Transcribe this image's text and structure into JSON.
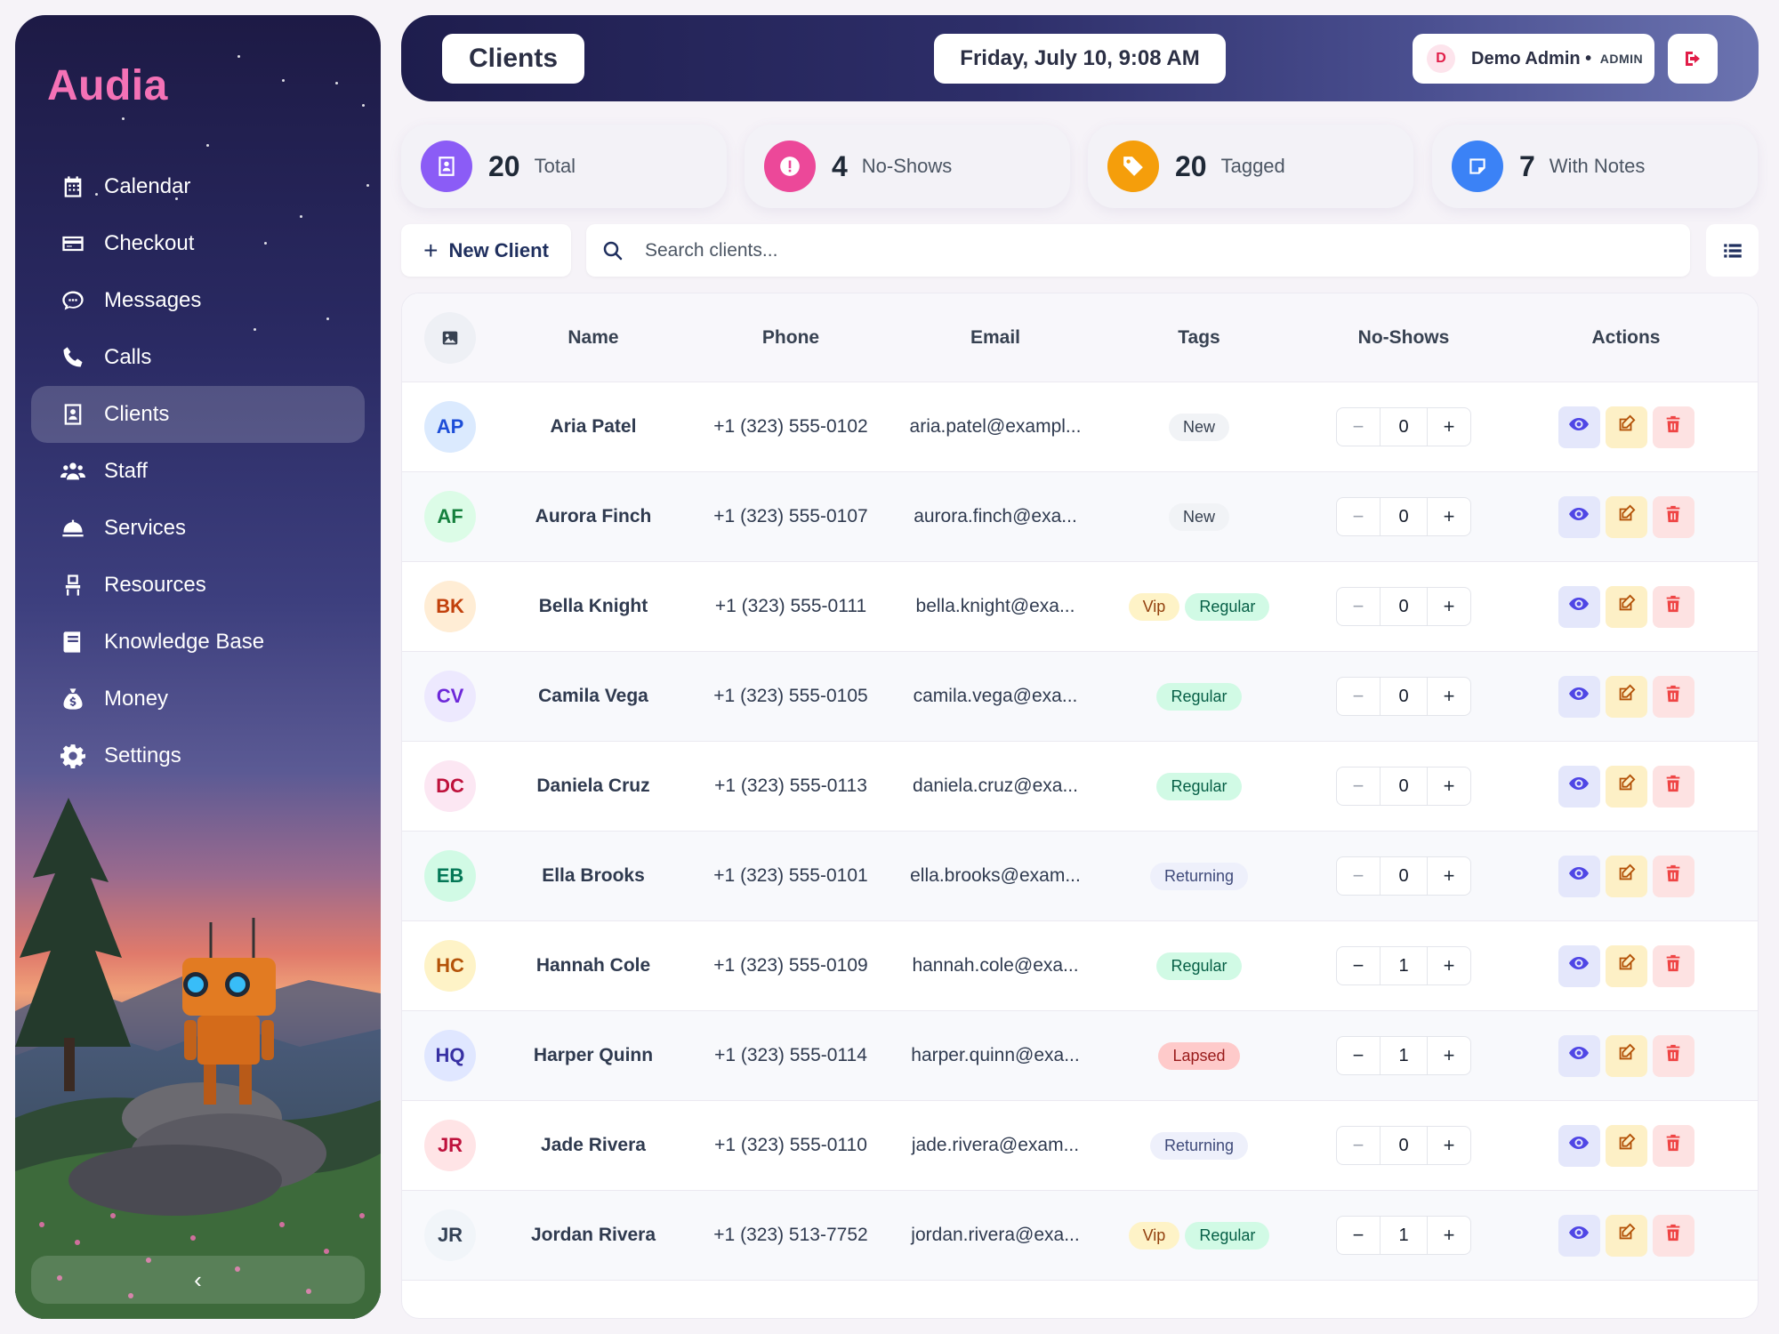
{
  "brand": "Audia",
  "nav": [
    {
      "label": "Calendar",
      "icon": "calendar-icon",
      "active": false
    },
    {
      "label": "Checkout",
      "icon": "credit-card-icon",
      "active": false
    },
    {
      "label": "Messages",
      "icon": "chat-bubble-icon",
      "active": false
    },
    {
      "label": "Calls",
      "icon": "phone-icon",
      "active": false
    },
    {
      "label": "Clients",
      "icon": "contact-card-icon",
      "active": true
    },
    {
      "label": "Staff",
      "icon": "users-icon",
      "active": false
    },
    {
      "label": "Services",
      "icon": "concierge-bell-icon",
      "active": false
    },
    {
      "label": "Resources",
      "icon": "chair-icon",
      "active": false
    },
    {
      "label": "Knowledge Base",
      "icon": "book-icon",
      "active": false
    },
    {
      "label": "Money",
      "icon": "money-bag-icon",
      "active": false
    },
    {
      "label": "Settings",
      "icon": "gear-icon",
      "active": false
    }
  ],
  "sidebar_collapse": "‹",
  "header": {
    "title": "Clients",
    "datetime": "Friday, July 10, 9:08 AM",
    "user_initial": "D",
    "user_name": "Demo Admin",
    "user_sep": " • ",
    "user_role": "ADMIN"
  },
  "stats": [
    {
      "value": "20",
      "label": "Total",
      "color": "#8b5cf6",
      "icon": "contact-card-icon"
    },
    {
      "value": "4",
      "label": "No-Shows",
      "color": "#ec4899",
      "icon": "alert-icon"
    },
    {
      "value": "20",
      "label": "Tagged",
      "color": "#f59e0b",
      "icon": "tag-icon"
    },
    {
      "value": "7",
      "label": "With Notes",
      "color": "#3b82f6",
      "icon": "note-icon"
    }
  ],
  "toolbar": {
    "new_client_label": "New Client",
    "search_placeholder": "Search clients..."
  },
  "table": {
    "headers": [
      "Name",
      "Phone",
      "Email",
      "Tags",
      "No-Shows",
      "Actions"
    ],
    "rows": [
      {
        "initials": "AP",
        "name": "Aria Patel",
        "phone": "+1 (323) 555-0102",
        "email": "aria.patel@exampl...",
        "tags": [
          "New"
        ],
        "noshows": "0",
        "av_bg": "#dbeafe",
        "av_fg": "#1d4ed8"
      },
      {
        "initials": "AF",
        "name": "Aurora Finch",
        "phone": "+1 (323) 555-0107",
        "email": "aurora.finch@exa...",
        "tags": [
          "New"
        ],
        "noshows": "0",
        "av_bg": "#dcfce7",
        "av_fg": "#15803d"
      },
      {
        "initials": "BK",
        "name": "Bella Knight",
        "phone": "+1 (323) 555-0111",
        "email": "bella.knight@exa...",
        "tags": [
          "Vip",
          "Regular"
        ],
        "noshows": "0",
        "av_bg": "#ffedd5",
        "av_fg": "#c2410c"
      },
      {
        "initials": "CV",
        "name": "Camila Vega",
        "phone": "+1 (323) 555-0105",
        "email": "camila.vega@exa...",
        "tags": [
          "Regular"
        ],
        "noshows": "0",
        "av_bg": "#ede9fe",
        "av_fg": "#6d28d9"
      },
      {
        "initials": "DC",
        "name": "Daniela Cruz",
        "phone": "+1 (323) 555-0113",
        "email": "daniela.cruz@exa...",
        "tags": [
          "Regular"
        ],
        "noshows": "0",
        "av_bg": "#fce7f3",
        "av_fg": "#be123c"
      },
      {
        "initials": "EB",
        "name": "Ella Brooks",
        "phone": "+1 (323) 555-0101",
        "email": "ella.brooks@exam...",
        "tags": [
          "Returning"
        ],
        "noshows": "0",
        "av_bg": "#d1fae5",
        "av_fg": "#047857"
      },
      {
        "initials": "HC",
        "name": "Hannah Cole",
        "phone": "+1 (323) 555-0109",
        "email": "hannah.cole@exa...",
        "tags": [
          "Regular"
        ],
        "noshows": "1",
        "av_bg": "#fef3c7",
        "av_fg": "#b45309"
      },
      {
        "initials": "HQ",
        "name": "Harper Quinn",
        "phone": "+1 (323) 555-0114",
        "email": "harper.quinn@exa...",
        "tags": [
          "Lapsed"
        ],
        "noshows": "1",
        "av_bg": "#e0e7ff",
        "av_fg": "#3730a3"
      },
      {
        "initials": "JR",
        "name": "Jade Rivera",
        "phone": "+1 (323) 555-0110",
        "email": "jade.rivera@exam...",
        "tags": [
          "Returning"
        ],
        "noshows": "0",
        "av_bg": "#ffe4e6",
        "av_fg": "#be123c"
      },
      {
        "initials": "JR",
        "name": "Jordan Rivera",
        "phone": "+1 (323) 513-7752",
        "email": "jordan.rivera@exa...",
        "tags": [
          "Vip",
          "Regular"
        ],
        "noshows": "1",
        "av_bg": "#f1f5f9",
        "av_fg": "#334155"
      }
    ]
  },
  "tag_colors": {
    "New": {
      "bg": "#f1f3f6",
      "fg": "#374151"
    },
    "Vip": {
      "bg": "#fef3c7",
      "fg": "#92400e"
    },
    "Regular": {
      "bg": "#d1fae5",
      "fg": "#065f46"
    },
    "Returning": {
      "bg": "#eef0fb",
      "fg": "#3f4a7a"
    },
    "Lapsed": {
      "bg": "#fecaca",
      "fg": "#991b1b"
    }
  }
}
